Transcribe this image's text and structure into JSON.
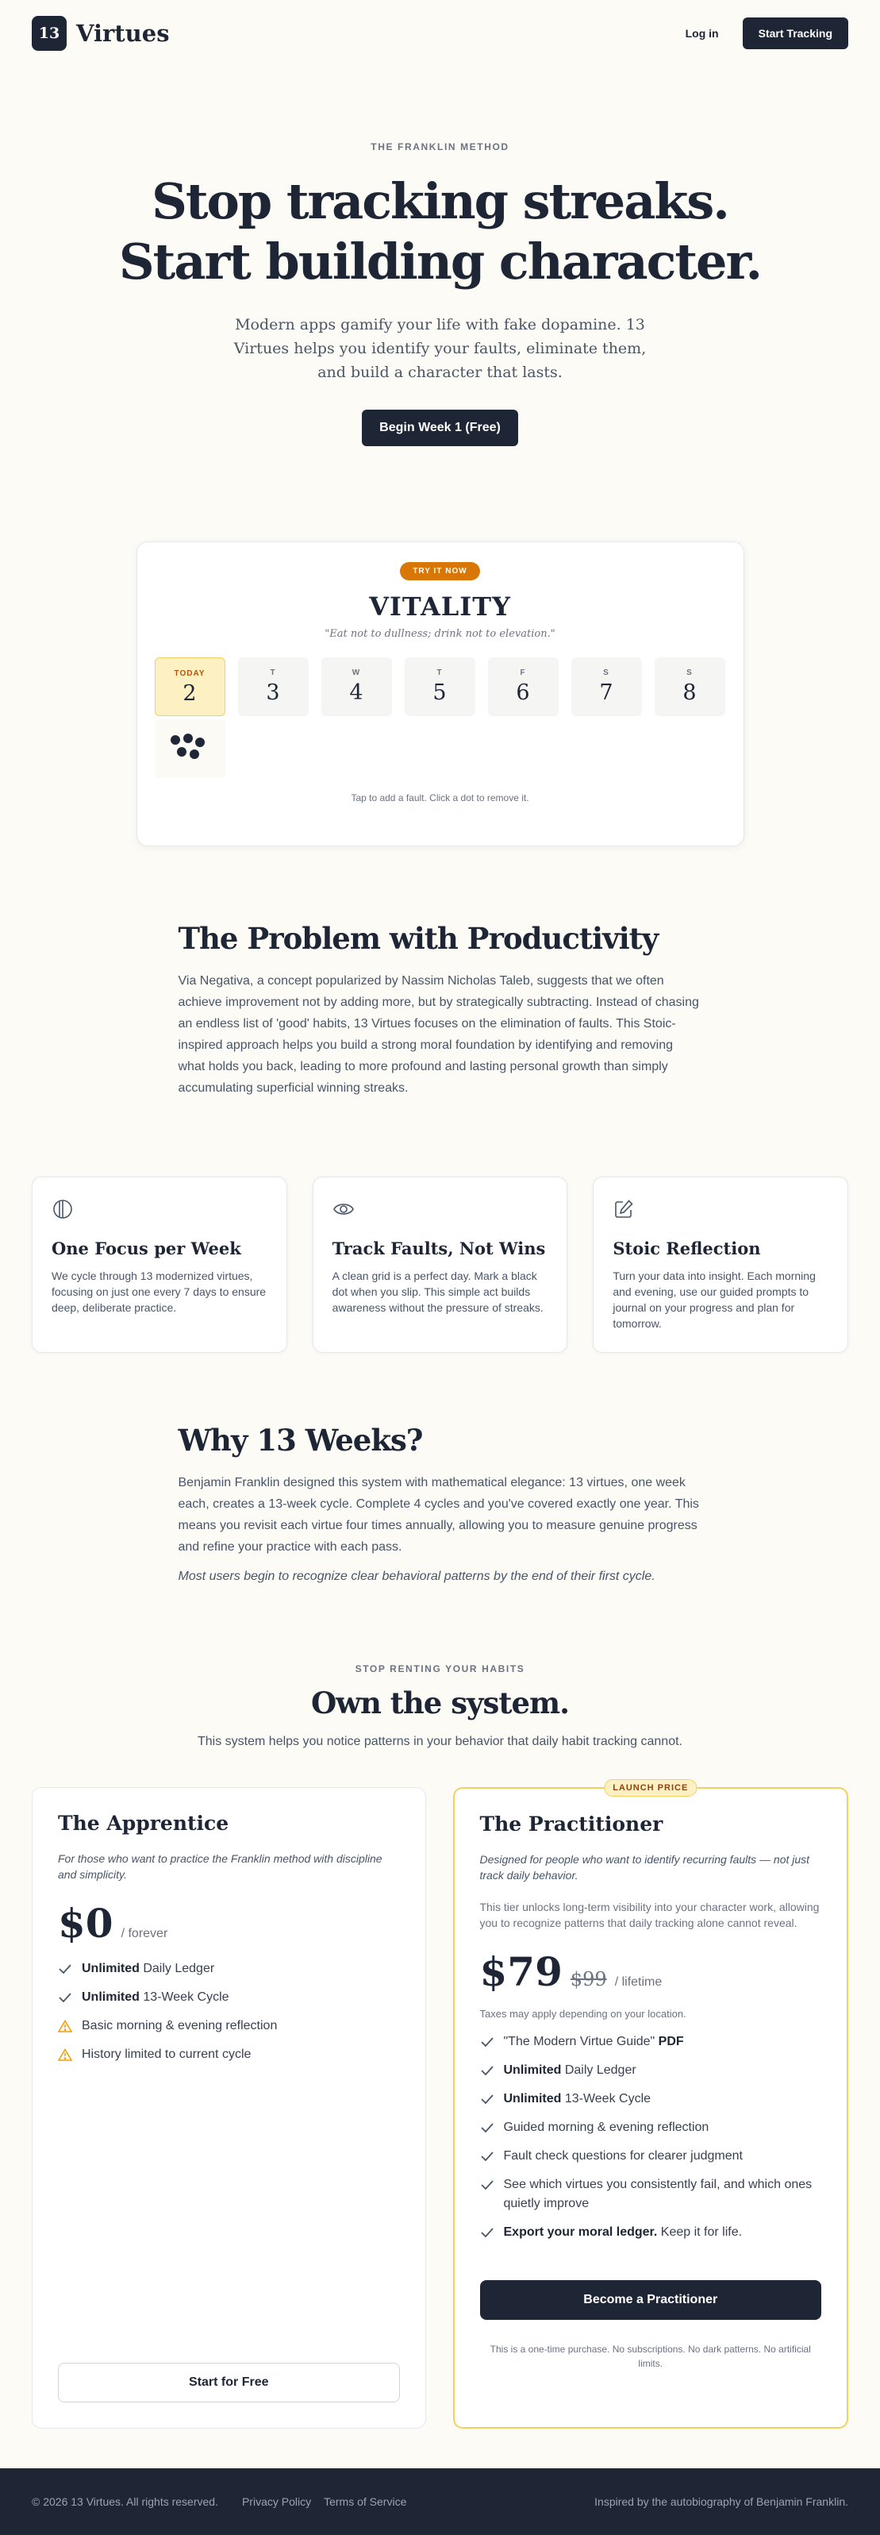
{
  "header": {
    "logo_number": "13",
    "brand": "Virtues",
    "login": "Log in",
    "cta": "Start Tracking"
  },
  "hero": {
    "eyebrow": "THE FRANKLIN METHOD",
    "title_line1": "Stop tracking streaks.",
    "title_line2": "Start building character.",
    "subtitle": "Modern apps gamify your life with fake dopamine. 13 Virtues helps you identify your faults, eliminate them, and build a character that lasts.",
    "button": "Begin Week 1 (Free)"
  },
  "demo": {
    "badge": "TRY IT NOW",
    "virtue": "VITALITY",
    "quote": "\"Eat not to dullness; drink not to elevation.\"",
    "days": [
      {
        "label": "TODAY",
        "num": "2"
      },
      {
        "label": "T",
        "num": "3"
      },
      {
        "label": "W",
        "num": "4"
      },
      {
        "label": "T",
        "num": "5"
      },
      {
        "label": "F",
        "num": "6"
      },
      {
        "label": "S",
        "num": "7"
      },
      {
        "label": "S",
        "num": "8"
      }
    ],
    "today_fault_count": 5,
    "hint": "Tap to add a fault. Click a dot to remove it."
  },
  "problem": {
    "title": "The Problem with Productivity",
    "body": "Via Negativa, a concept popularized by Nassim Nicholas Taleb, suggests that we often achieve improvement not by adding more, but by strategically subtracting. Instead of chasing an endless list of 'good' habits, 13 Virtues focuses on the elimination of faults. This Stoic-inspired approach helps you build a strong moral foundation by identifying and removing what holds you back, leading to more profound and lasting personal growth than simply accumulating superficial winning streaks."
  },
  "features": [
    {
      "icon": "half-circle-icon",
      "title": "One Focus per Week",
      "text": "We cycle through 13 modernized virtues, focusing on just one every 7 days to ensure deep, deliberate practice."
    },
    {
      "icon": "eye-icon",
      "title": "Track Faults, Not Wins",
      "text": "A clean grid is a perfect day. Mark a black dot when you slip. This simple act builds awareness without the pressure of streaks."
    },
    {
      "icon": "edit-icon",
      "title": "Stoic Reflection",
      "text": "Turn your data into insight. Each morning and evening, use our guided prompts to journal on your progress and plan for tomorrow."
    }
  ],
  "why": {
    "title": "Why 13 Weeks?",
    "body": "Benjamin Franklin designed this system with mathematical elegance: 13 virtues, one week each, creates a 13-week cycle. Complete 4 cycles and you've covered exactly one year. This means you revisit each virtue four times annually, allowing you to measure genuine progress and refine your practice with each pass.",
    "note": "Most users begin to recognize clear behavioral patterns by the end of their first cycle."
  },
  "pricing": {
    "eyebrow": "STOP RENTING YOUR HABITS",
    "title": "Own the system.",
    "subtitle": "This system helps you notice patterns in your behavior that daily habit tracking cannot.",
    "apprentice": {
      "name": "The Apprentice",
      "desc": "For those who want to practice the Franklin method with discipline and simplicity.",
      "price": "$0",
      "term": "/ forever",
      "features": [
        {
          "bold": "Unlimited",
          "text": " Daily Ledger",
          "icon": "check-icon"
        },
        {
          "bold": "Unlimited",
          "text": " 13-Week Cycle",
          "icon": "check-icon"
        },
        {
          "bold": "",
          "text": "Basic morning & evening reflection",
          "icon": "warning-icon"
        },
        {
          "bold": "",
          "text": "History limited to current cycle",
          "icon": "warning-icon"
        }
      ],
      "button": "Start for Free"
    },
    "practitioner": {
      "badge": "LAUNCH PRICE",
      "name": "The Practitioner",
      "desc": "Designed for people who want to identify recurring faults — not just track daily behavior.",
      "extra": "This tier unlocks long-term visibility into your character work, allowing you to recognize patterns that daily tracking alone cannot reveal.",
      "price": "$79",
      "old_price": "$99",
      "term": "/ lifetime",
      "tax_note": "Taxes may apply depending on your location.",
      "features": [
        {
          "pre": "\"The Modern Virtue Guide\" ",
          "bold": "PDF",
          "post": ""
        },
        {
          "pre": "",
          "bold": "Unlimited",
          "post": " Daily Ledger"
        },
        {
          "pre": "",
          "bold": "Unlimited",
          "post": " 13-Week Cycle"
        },
        {
          "pre": "Guided morning & evening reflection",
          "bold": "",
          "post": ""
        },
        {
          "pre": "Fault check questions for clearer judgment",
          "bold": "",
          "post": ""
        },
        {
          "pre": "See which virtues you consistently fail, and which ones quietly improve",
          "bold": "",
          "post": ""
        },
        {
          "pre": "",
          "bold": "Export your moral ledger.",
          "post": " Keep it for life."
        }
      ],
      "button": "Become a Practitioner",
      "fine_print": "This is a one-time purchase. No subscriptions. No dark patterns. No artificial limits."
    }
  },
  "footer": {
    "copyright": "© 2026 13 Virtues. All rights reserved.",
    "privacy": "Privacy Policy",
    "terms": "Terms of Service",
    "credit": "Inspired by the autobiography of Benjamin Franklin."
  },
  "colors": {
    "navy": "#1e2535",
    "background": "#fcfbf6",
    "accent_orange": "#d97706",
    "accent_gold": "#f4cf63",
    "warning": "#f59e0b"
  }
}
